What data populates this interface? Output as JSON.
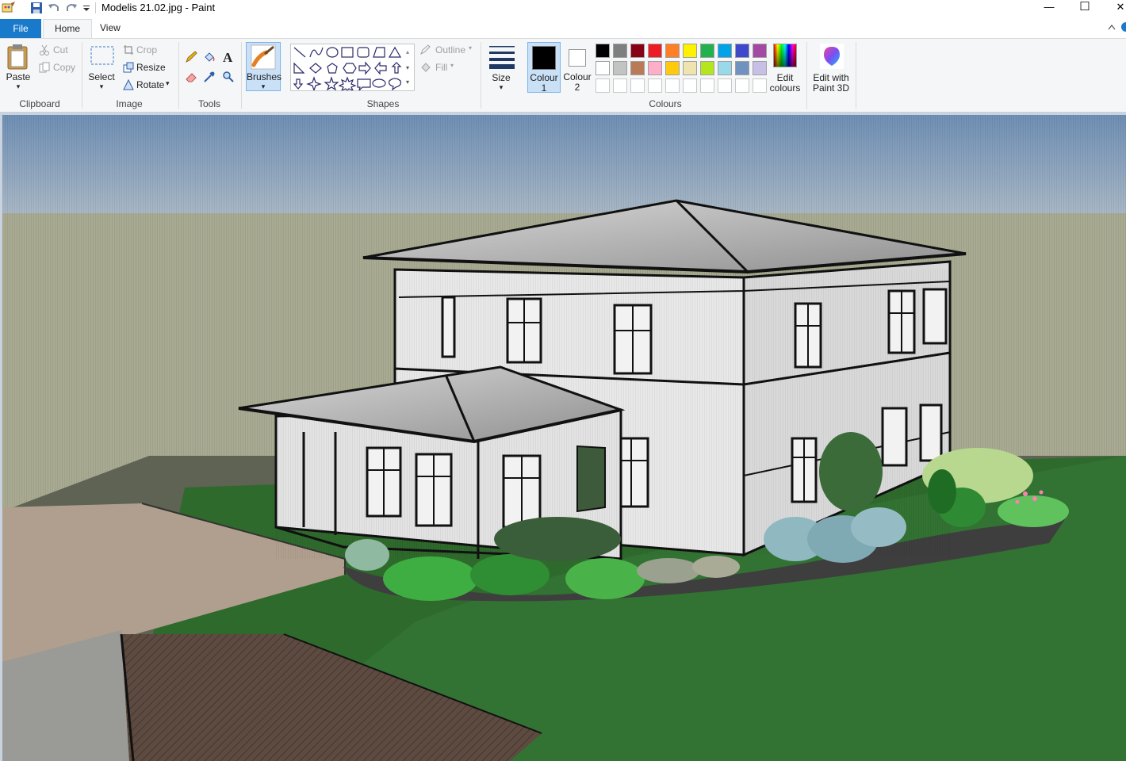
{
  "window": {
    "title": "Modelis 21.02.jpg - Paint",
    "minimize": "—",
    "maximize": "☐",
    "close": "✕"
  },
  "tabs": {
    "file": "File",
    "home": "Home",
    "view": "View"
  },
  "clipboard": {
    "paste": "Paste",
    "cut": "Cut",
    "copy": "Copy",
    "label": "Clipboard"
  },
  "image": {
    "select": "Select",
    "crop": "Crop",
    "resize": "Resize",
    "rotate": "Rotate",
    "label": "Image"
  },
  "tools": {
    "label": "Tools"
  },
  "brushes": {
    "label": "Brushes"
  },
  "shapes": {
    "outline": "Outline",
    "fill": "Fill",
    "label": "Shapes"
  },
  "size": {
    "label": "Size"
  },
  "colours": {
    "colour1_line1": "Colour",
    "colour1_line2": "1",
    "colour2_line1": "Colour",
    "colour2_line2": "2",
    "edit_line1": "Edit",
    "edit_line2": "colours",
    "label": "Colours",
    "palette_row1": [
      "#000000",
      "#7f7f7f",
      "#880015",
      "#ed1c24",
      "#ff7f27",
      "#fff200",
      "#22b14c",
      "#00a2e8",
      "#3f48cc",
      "#a349a4"
    ],
    "palette_row2": [
      "#ffffff",
      "#c3c3c3",
      "#b97a57",
      "#ffaec9",
      "#ffc90e",
      "#efe4b0",
      "#b5e61d",
      "#99d9ea",
      "#7092be",
      "#c8bfe7"
    ]
  },
  "paint3d": {
    "line1": "Edit with",
    "line2": "Paint 3D"
  }
}
